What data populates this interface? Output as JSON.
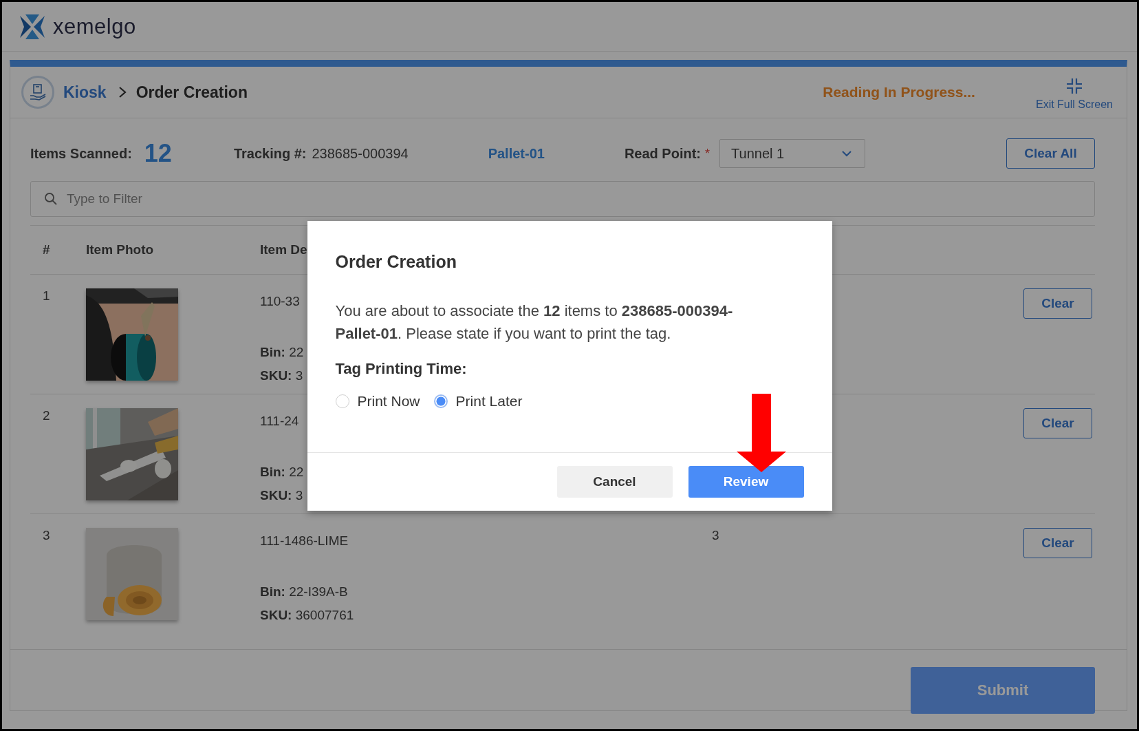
{
  "brand": {
    "name": "xemelgo"
  },
  "breadcrumb": {
    "parent": "Kiosk",
    "current": "Order Creation"
  },
  "status": "Reading In Progress...",
  "exit_full_screen": "Exit Full Screen",
  "summary": {
    "items_label": "Items Scanned:",
    "items_count": "12",
    "tracking_label": "Tracking #:",
    "tracking_value": "238685-000394",
    "pallet": "Pallet-01",
    "read_point_label": "Read Point:",
    "required_mark": "*",
    "read_point_value": "Tunnel 1",
    "clear_all": "Clear All"
  },
  "filter": {
    "placeholder": "Type to Filter"
  },
  "table": {
    "columns": [
      "#",
      "Item Photo",
      "Item De"
    ],
    "rows": [
      {
        "index": "1",
        "code": "110-33",
        "bin": "**Bin:** 22",
        "sku": "**SKU:** 3",
        "quantity": "",
        "action": "Clear"
      },
      {
        "index": "2",
        "code": "111-24",
        "bin": "**Bin:** 22",
        "sku": "**SKU:** 3",
        "quantity": "",
        "action": "Clear"
      },
      {
        "index": "3",
        "code": "111-1486-LIME",
        "bin": "**Bin:** 22-I39A-B",
        "sku": "**SKU:** 36007761",
        "quantity": "3",
        "action": "Clear"
      }
    ]
  },
  "submit": "Submit",
  "dialog": {
    "title": "Order Creation",
    "message": "You are about to associate the **12** items to **238685-000394-Pallet-01**. Please state if you want to print the tag.",
    "option_label": "Tag Printing Time:",
    "options": [
      {
        "label": "Print Now",
        "selected": false
      },
      {
        "label": "Print Later",
        "selected": true
      }
    ],
    "buttons": [
      {
        "label": "Cancel",
        "kind": "secondary"
      },
      {
        "label": "Review",
        "kind": "primary"
      }
    ]
  }
}
